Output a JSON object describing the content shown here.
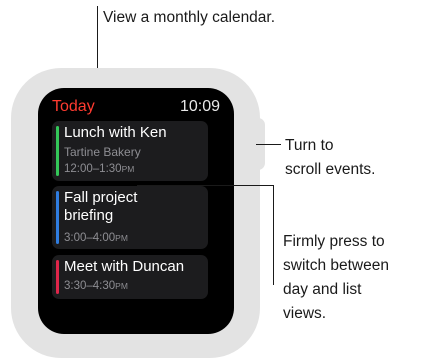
{
  "callouts": {
    "top": "View a monthly calendar.",
    "crown_line1": "Turn to",
    "crown_line2": "scroll events.",
    "press_line1": "Firmly press to",
    "press_line2": "switch between",
    "press_line3": "day and list",
    "press_line4": "views."
  },
  "screen": {
    "title": "Today",
    "time": "10:09"
  },
  "events": [
    {
      "name": "Lunch with Ken",
      "location": "Tartine Bakery",
      "time": "12:00–1:30",
      "ampm": "PM",
      "color": "#34c759"
    },
    {
      "name": "Fall project\nbriefing",
      "time": "3:00–4:00",
      "ampm": "PM",
      "color": "#2f7de1"
    },
    {
      "name": "Meet with Duncan",
      "time": "3:30–4:30",
      "ampm": "PM",
      "color": "#e0264a"
    }
  ],
  "colors": {
    "accent": "#ff3b30",
    "case": "#e3e3e3",
    "screen": "#000000"
  }
}
